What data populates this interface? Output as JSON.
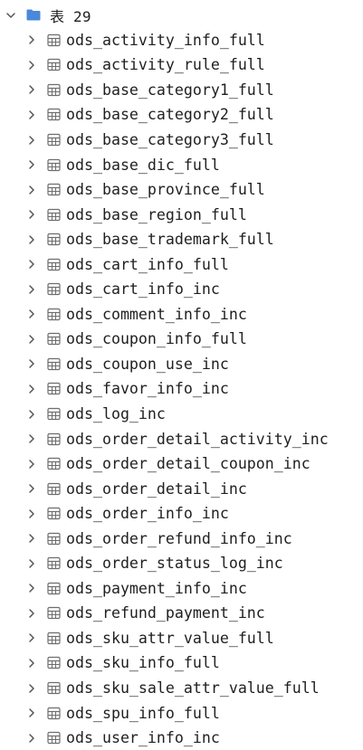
{
  "group": {
    "label": "表 29",
    "expanded": true,
    "icon": "folder-icon"
  },
  "tables": [
    "ods_activity_info_full",
    "ods_activity_rule_full",
    "ods_base_category1_full",
    "ods_base_category2_full",
    "ods_base_category3_full",
    "ods_base_dic_full",
    "ods_base_province_full",
    "ods_base_region_full",
    "ods_base_trademark_full",
    "ods_cart_info_full",
    "ods_cart_info_inc",
    "ods_comment_info_inc",
    "ods_coupon_info_full",
    "ods_coupon_use_inc",
    "ods_favor_info_inc",
    "ods_log_inc",
    "ods_order_detail_activity_inc",
    "ods_order_detail_coupon_inc",
    "ods_order_detail_inc",
    "ods_order_info_inc",
    "ods_order_refund_info_inc",
    "ods_order_status_log_inc",
    "ods_payment_info_inc",
    "ods_refund_payment_inc",
    "ods_sku_attr_value_full",
    "ods_sku_info_full",
    "ods_sku_sale_attr_value_full",
    "ods_spu_info_full",
    "ods_user_info_inc"
  ],
  "colors": {
    "folder": "#4a88d9",
    "chevron": "#555555",
    "table_icon": "#6d6d6d",
    "text": "#1f1f1f"
  }
}
